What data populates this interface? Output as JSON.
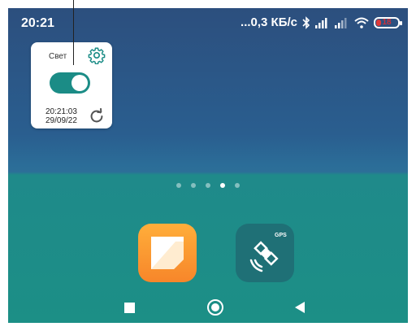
{
  "status_bar": {
    "time": "20:21",
    "network_speed": "...0,3 КБ/с",
    "battery_level": "18",
    "icons": [
      "bluetooth-icon",
      "signal-icon",
      "signal-icon",
      "wifi-icon",
      "battery-icon"
    ]
  },
  "widget": {
    "title": "Свет",
    "toggle_state": "on",
    "time": "20:21:03",
    "date": "29/09/22",
    "accent_color": "#1b8c86",
    "icons": [
      "gear-icon",
      "refresh-icon"
    ]
  },
  "home_screen": {
    "page_dots_count": 5,
    "active_page": 4,
    "apps": [
      {
        "icon": "notes-app-icon"
      },
      {
        "icon": "gps-app-icon",
        "badge_text": "GPS"
      }
    ]
  },
  "navigation": {
    "icons": [
      "recents-icon",
      "home-icon",
      "back-icon"
    ]
  },
  "colors": {
    "wallpaper_top": "#2c4f7e",
    "wallpaper_bottom": "#1c8f86"
  }
}
